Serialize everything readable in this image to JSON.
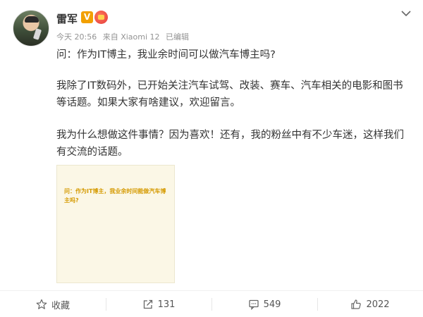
{
  "post": {
    "author": {
      "name": "雷军",
      "verified_badge": "V"
    },
    "meta": {
      "time": "今天 20:56",
      "source": "来自 Xiaomi 12",
      "edited": "已编辑"
    },
    "paragraphs": [
      "问：作为IT博主，我业余时间可以做汽车博主吗?",
      "我除了IT数码外，已开始关注汽车试驾、改装、赛车、汽车相关的电影和图书等话题。如果大家有啥建议，欢迎留言。",
      "我为什么想做这件事情？因为喜欢！还有，我的粉丝中有不少车迷，这样我们有交流的话题。"
    ],
    "image": {
      "text": "问：作为IT博主，我业余时间能做汽车博主吗?"
    }
  },
  "actions": {
    "favorite": {
      "label": "收藏",
      "icon": "star-icon"
    },
    "repost": {
      "label": "131",
      "icon": "repost-icon"
    },
    "comment": {
      "label": "549",
      "icon": "comment-icon"
    },
    "like": {
      "label": "2022",
      "icon": "thumbs-up-icon"
    }
  },
  "colors": {
    "verified": "#f2a000",
    "image_text": "#d59a00",
    "image_bg": "#fbf7e6",
    "meta": "#939393"
  }
}
